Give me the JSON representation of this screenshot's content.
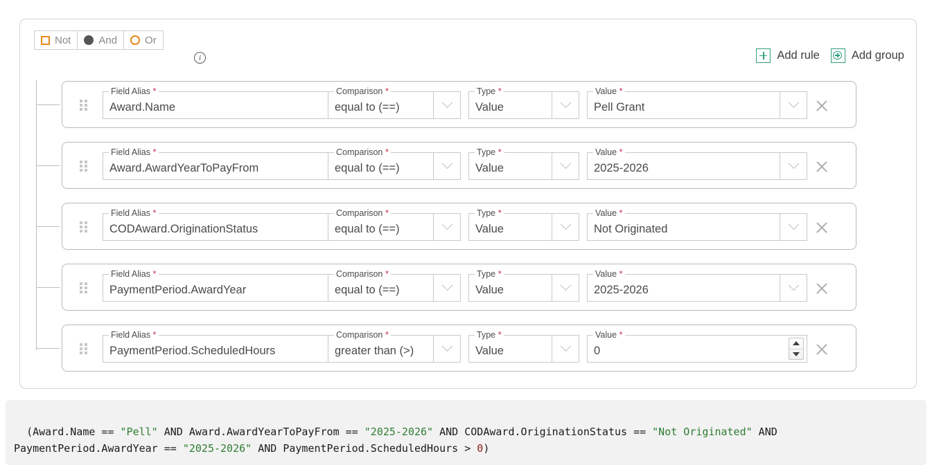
{
  "header": {
    "not_label": "Not",
    "and_label": "And",
    "or_label": "Or",
    "info_glyph": "i",
    "add_rule_label": "Add rule",
    "add_group_label": "Add group",
    "selected_operator": "And",
    "not_checked": false
  },
  "labels": {
    "field_alias": "Field Alias",
    "comparison": "Comparison",
    "type": "Type",
    "value": "Value",
    "required_mark": "*"
  },
  "rules": [
    {
      "field_alias": "Award.Name",
      "comparison": "equal to (==)",
      "type": "Value",
      "value": "Pell Grant",
      "value_control": "dropdown"
    },
    {
      "field_alias": "Award.AwardYearToPayFrom",
      "comparison": "equal to (==)",
      "type": "Value",
      "value": "2025-2026",
      "value_control": "dropdown"
    },
    {
      "field_alias": "CODAward.OriginationStatus",
      "comparison": "equal to (==)",
      "type": "Value",
      "value": "Not Originated",
      "value_control": "dropdown"
    },
    {
      "field_alias": "PaymentPeriod.AwardYear",
      "comparison": "equal to (==)",
      "type": "Value",
      "value": "2025-2026",
      "value_control": "dropdown"
    },
    {
      "field_alias": "PaymentPeriod.ScheduledHours",
      "comparison": "greater than (>)",
      "type": "Value",
      "value": "0",
      "value_control": "stepper"
    }
  ],
  "expression": {
    "tokens": [
      {
        "t": "(Award.Name == ",
        "k": "plain"
      },
      {
        "t": "\"Pell\"",
        "k": "str"
      },
      {
        "t": " AND Award.AwardYearToPayFrom == ",
        "k": "plain"
      },
      {
        "t": "\"2025-2026\"",
        "k": "str"
      },
      {
        "t": " AND CODAward.OriginationStatus == ",
        "k": "plain"
      },
      {
        "t": "\"Not Originated\"",
        "k": "str"
      },
      {
        "t": " AND PaymentPeriod.AwardYear == ",
        "k": "plain"
      },
      {
        "t": "\"2025-2026\"",
        "k": "str"
      },
      {
        "t": " AND PaymentPeriod.ScheduledHours > ",
        "k": "plain"
      },
      {
        "t": "0",
        "k": "num"
      },
      {
        "t": ")",
        "k": "plain"
      }
    ],
    "plain_text": "(Award.Name == \"Pell\" AND Award.AwardYearToPayFrom == \"2025-2026\" AND CODAward.OriginationStatus == \"Not Originated\" AND PaymentPeriod.AwardYear == \"2025-2026\" AND PaymentPeriod.ScheduledHours > 0)"
  },
  "colors": {
    "accent_green": "#2e9e7e",
    "accent_orange": "#e8871a",
    "required_red": "#c0334b",
    "string_green": "#2e7d32",
    "number_red": "#8b1a1a"
  }
}
